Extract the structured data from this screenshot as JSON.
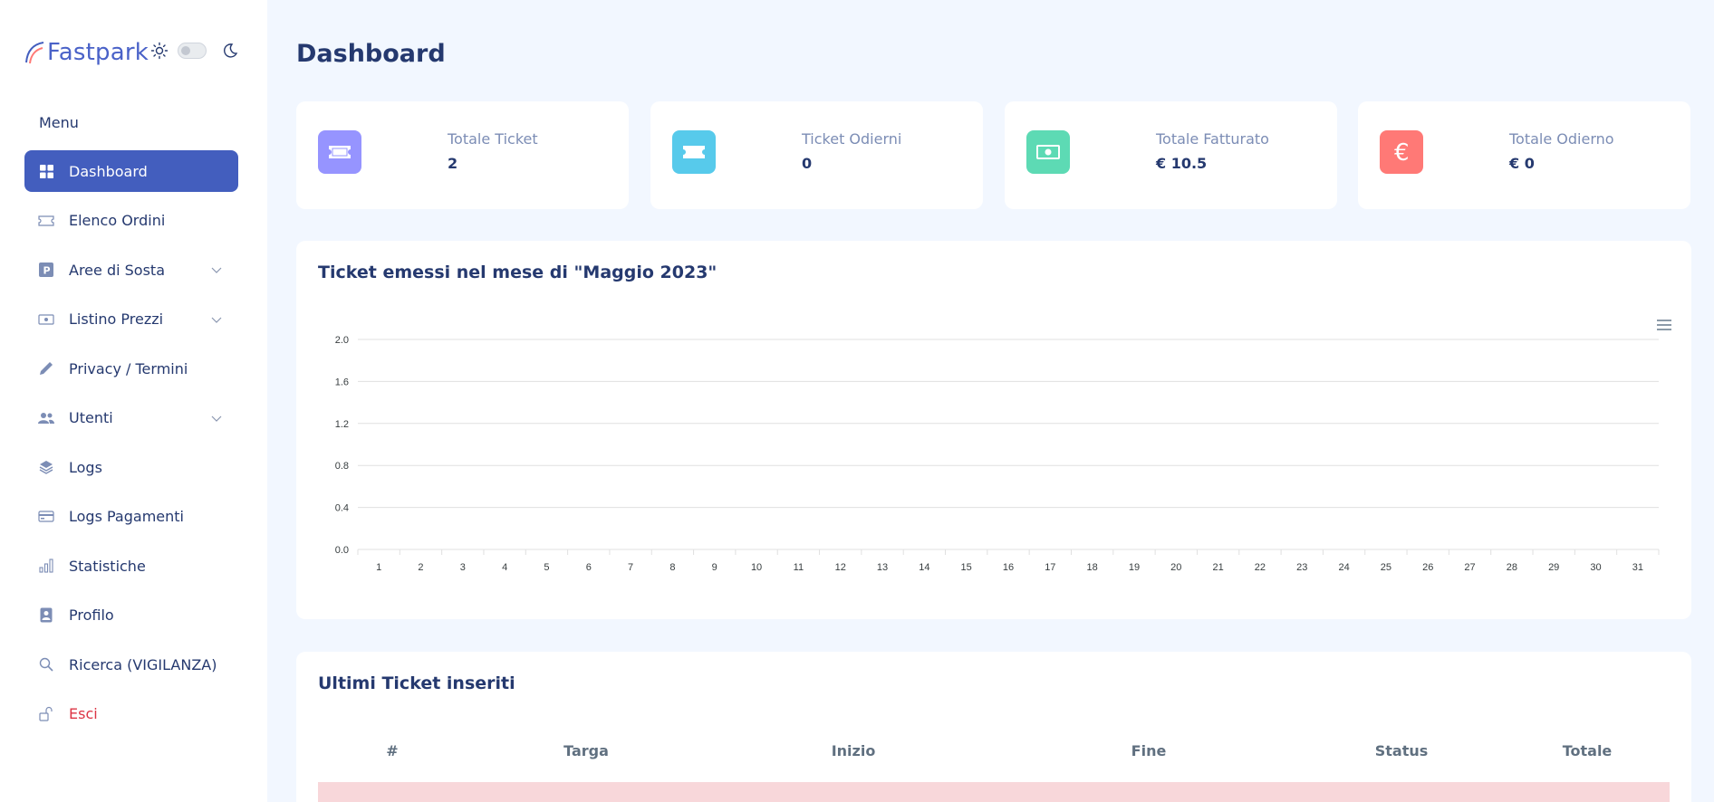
{
  "app": {
    "name": "Fastpark"
  },
  "sidebar": {
    "menu_title": "Menu",
    "items": [
      {
        "label": "Dashboard",
        "icon": "grid-icon",
        "active": true
      },
      {
        "label": "Elenco Ordini",
        "icon": "ticket-icon"
      },
      {
        "label": "Aree di Sosta",
        "icon": "parking-icon",
        "has_submenu": true
      },
      {
        "label": "Listino Prezzi",
        "icon": "cash-icon",
        "has_submenu": true
      },
      {
        "label": "Privacy / Termini",
        "icon": "pen-icon"
      },
      {
        "label": "Utenti",
        "icon": "people-icon",
        "has_submenu": true
      },
      {
        "label": "Logs",
        "icon": "layers-icon"
      },
      {
        "label": "Logs Pagamenti",
        "icon": "credit-card-icon"
      },
      {
        "label": "Statistiche",
        "icon": "bar-chart-icon"
      },
      {
        "label": "Profilo",
        "icon": "person-badge-icon"
      },
      {
        "label": "Ricerca (VIGILANZA)",
        "icon": "search-icon"
      },
      {
        "label": "Esci",
        "icon": "unlock-icon",
        "danger": true
      }
    ]
  },
  "main": {
    "page_title": "Dashboard",
    "stats": [
      {
        "label": "Totale Ticket",
        "value": "2",
        "icon": "ticket-icon",
        "color": "#9694ff"
      },
      {
        "label": "Ticket Odierni",
        "value": "0",
        "icon": "ticket-icon",
        "color": "#57caeb"
      },
      {
        "label": "Totale Fatturato",
        "value": "€ 10.5",
        "icon": "cash-icon",
        "color": "#5ddab4"
      },
      {
        "label": "Totale Odierno",
        "value": "€ 0",
        "icon": "euro-icon",
        "color": "#ff7976"
      }
    ],
    "chart_card": {
      "title": "Ticket emessi nel mese di \"Maggio 2023\""
    },
    "table_card": {
      "title": "Ultimi Ticket inseriti",
      "columns": [
        "#",
        "Targa",
        "Inizio",
        "Fine",
        "Status",
        "Totale"
      ]
    }
  },
  "chart_data": {
    "type": "line",
    "categories": [
      "1",
      "2",
      "3",
      "4",
      "5",
      "6",
      "7",
      "8",
      "9",
      "10",
      "11",
      "12",
      "13",
      "14",
      "15",
      "16",
      "17",
      "18",
      "19",
      "20",
      "21",
      "22",
      "23",
      "24",
      "25",
      "26",
      "27",
      "28",
      "29",
      "30",
      "31"
    ],
    "values": [
      0,
      0,
      0,
      0,
      0,
      0,
      0,
      0,
      0,
      0,
      0,
      0,
      0,
      0,
      0,
      0,
      0,
      0,
      0,
      0,
      0,
      0,
      0,
      0,
      0,
      0,
      0,
      0,
      0,
      0,
      0
    ],
    "yticks": [
      "0.0",
      "0.4",
      "0.8",
      "1.2",
      "1.6",
      "2.0"
    ],
    "ylim": [
      0,
      2
    ],
    "grid": true,
    "color": "#435ebe"
  }
}
